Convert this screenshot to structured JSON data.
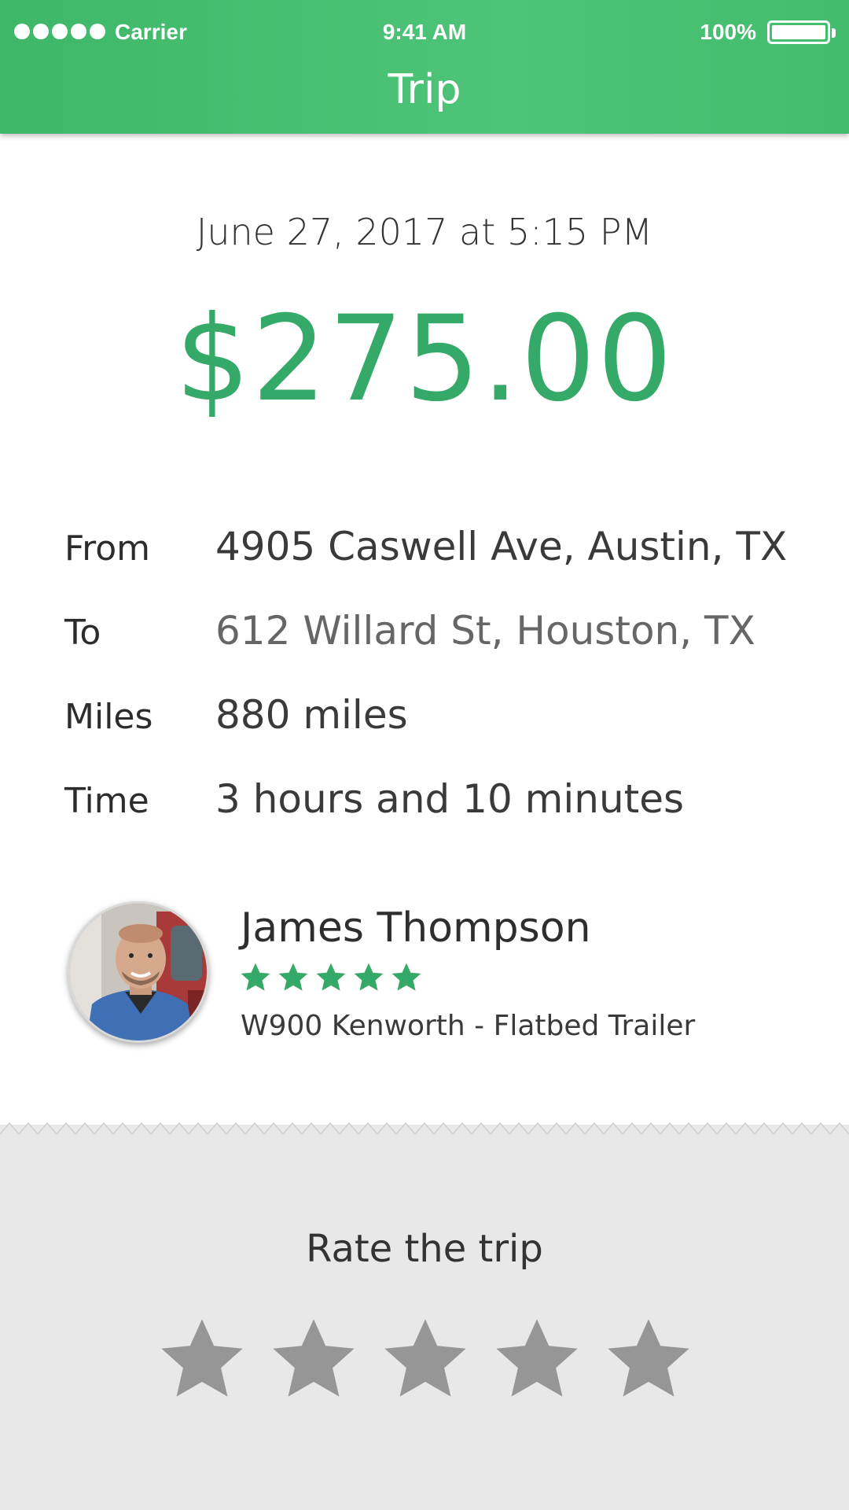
{
  "status_bar": {
    "carrier": "Carrier",
    "time": "9:41 AM",
    "battery": "100%",
    "signal_bars": 5
  },
  "header": {
    "title": "Trip"
  },
  "trip": {
    "date": "June 27, 2017 at 5:15 PM",
    "amount": "$275.00",
    "details": [
      {
        "label": "From",
        "value": "4905 Caswell Ave, Austin, TX"
      },
      {
        "label": "To",
        "value": "612 Willard St, Houston, TX"
      },
      {
        "label": "Miles",
        "value": "880 miles"
      },
      {
        "label": "Time",
        "value": "3 hours and 10 minutes"
      }
    ]
  },
  "driver": {
    "name": "James Thompson",
    "rating": 5,
    "vehicle": "W900 Kenworth - Flatbed Trailer",
    "avatar_icon": "driver-photo"
  },
  "rating": {
    "prompt": "Rate the trip",
    "max_stars": 5,
    "selected": 0
  },
  "colors": {
    "accent": "#35a967",
    "header": "#46bd70",
    "star_empty": "#969696",
    "rate_background": "#e8e8e8"
  }
}
